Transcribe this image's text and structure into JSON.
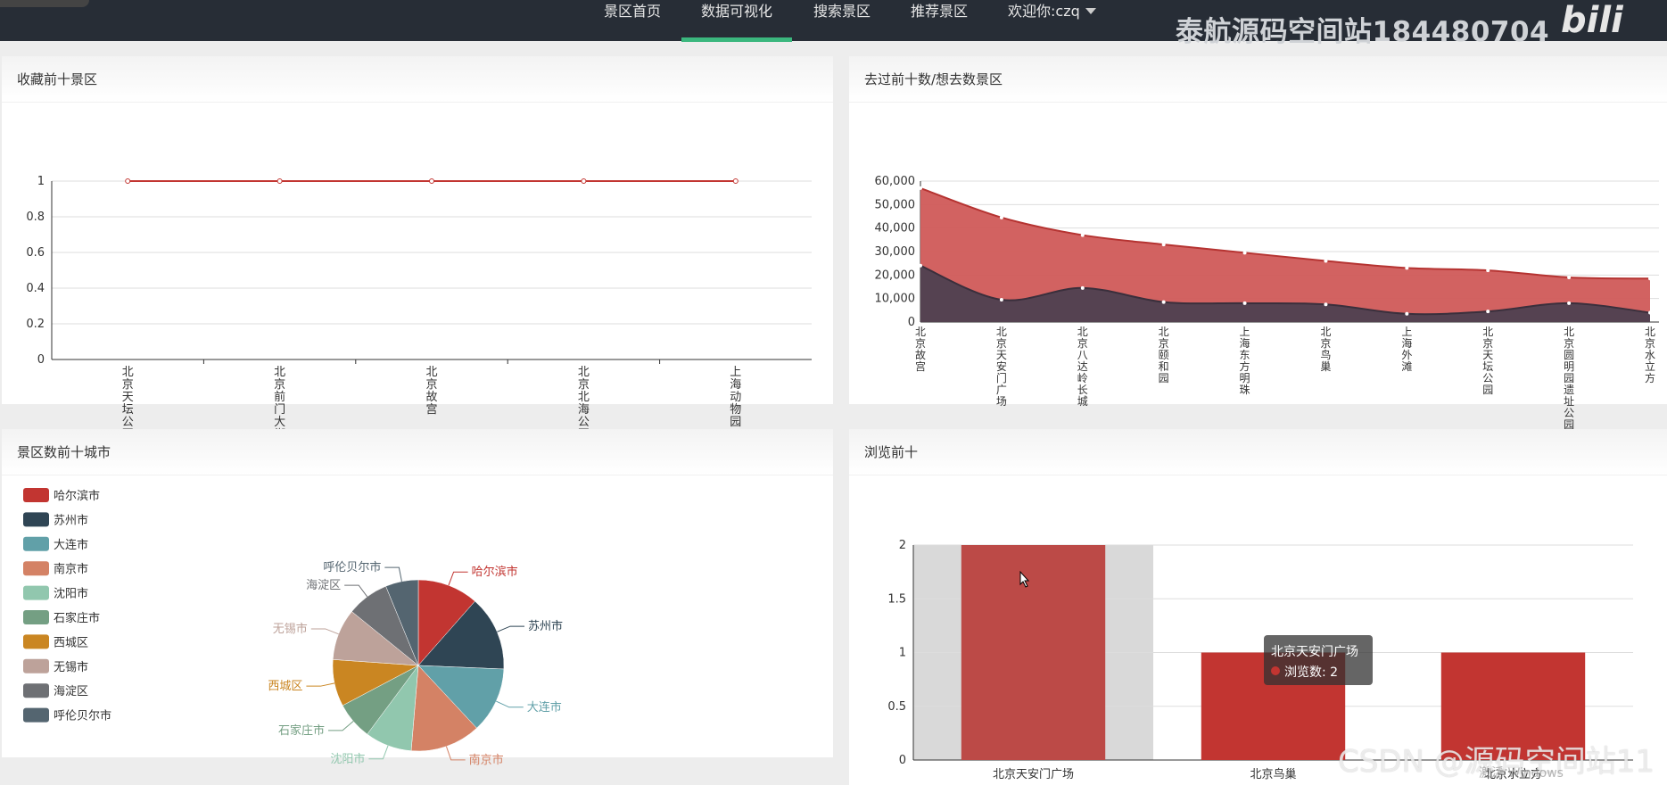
{
  "nav": {
    "items": [
      "景区首页",
      "数据可视化",
      "搜索景区",
      "推荐景区"
    ],
    "user": "欢迎你:czq",
    "active_index": 1
  },
  "watermark": {
    "top": "泰航源码空间站184480704",
    "logo": "bilibili",
    "bottom": "CSDN @源码空间站11",
    "activate": "激活 Windows"
  },
  "colors": {
    "red": "#c23531",
    "dark": "#2f4554",
    "accent": "#3bb77e"
  },
  "panels": {
    "collect_title": "收藏前十景区",
    "visit_title": "去过前十数/想去数景区",
    "city_title": "景区数前十城市",
    "browse_title": "浏览前十"
  },
  "chart_data": [
    {
      "type": "line",
      "categories": [
        "北京天坛公园",
        "北京前门大街",
        "北京故宫",
        "北京北海公园",
        "上海动物园"
      ],
      "values": [
        1,
        1,
        1,
        1,
        1
      ],
      "ylim": [
        0,
        1
      ],
      "yticks": [
        "0",
        "0.2",
        "0.4",
        "0.6",
        "0.8",
        "1"
      ]
    },
    {
      "type": "area",
      "categories": [
        "北京故宫",
        "北京天安门广场",
        "北京八达岭长城",
        "北京颐和园",
        "上海东方明珠",
        "北京鸟巢",
        "上海外滩",
        "北京天坛公园",
        "北京圆明园遗址公园",
        "北京水立方"
      ],
      "series": [
        {
          "values": [
            57000,
            44500,
            37000,
            33000,
            29500,
            26000,
            23000,
            22000,
            19000,
            18500
          ]
        },
        {
          "values": [
            24000,
            9500,
            14500,
            8500,
            8000,
            7500,
            3500,
            4500,
            8000,
            4000
          ]
        }
      ],
      "ylim": [
        0,
        60000
      ],
      "yticks": [
        "0",
        "10,000",
        "20,000",
        "30,000",
        "40,000",
        "50,000",
        "60,000"
      ]
    },
    {
      "type": "pie",
      "labels": [
        "哈尔滨市",
        "苏州市",
        "大连市",
        "南京市",
        "沈阳市",
        "石家庄市",
        "西城区",
        "无锡市",
        "海淀区",
        "呼伦贝尔市"
      ],
      "values": [
        1.3,
        1.6,
        1.4,
        1.5,
        1.0,
        0.8,
        1.0,
        1.1,
        0.9,
        0.7
      ],
      "colors": [
        "#c23531",
        "#2f4554",
        "#61a0a8",
        "#d48265",
        "#91c7ae",
        "#749f83",
        "#ca8622",
        "#bda29a",
        "#6e7074",
        "#546570"
      ],
      "legend": "left"
    },
    {
      "type": "bar",
      "categories": [
        "北京天安门广场",
        "北京鸟巢",
        "北京水立方"
      ],
      "values": [
        2,
        1,
        1
      ],
      "ylim": [
        0,
        2
      ],
      "yticks": [
        "0",
        "0.5",
        "1",
        "1.5",
        "2"
      ],
      "tooltip": {
        "title": "北京天安门广场",
        "label": "浏览数: 2"
      }
    }
  ]
}
